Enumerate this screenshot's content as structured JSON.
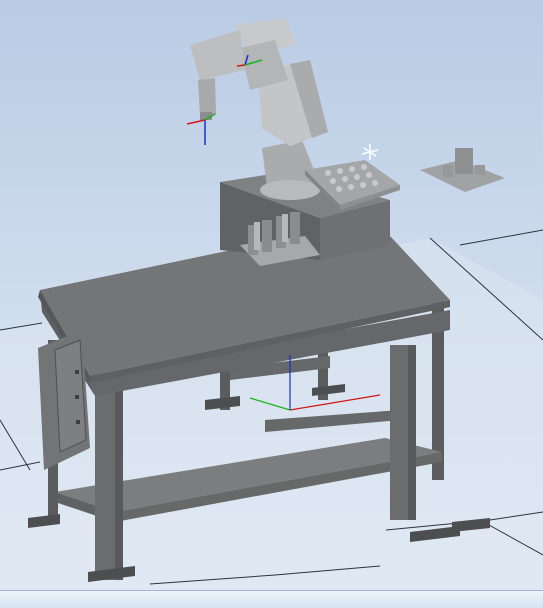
{
  "viewport": {
    "background_top": "#b9cce4",
    "background_bottom": "#e4ecf6",
    "floor_color": "#dde6f0",
    "floor_line_color": "#2c3440"
  },
  "scene": {
    "objects": [
      {
        "name": "workbench-table",
        "color": "#6f7173"
      },
      {
        "name": "robot-pedestal",
        "color": "#7a7c7e"
      },
      {
        "name": "industrial-robot-arm",
        "color": "#c4c6c8"
      },
      {
        "name": "electrical-cabinet",
        "color": "#717375"
      },
      {
        "name": "tool-rack",
        "color": "#9c9ea0"
      },
      {
        "name": "pin-fixture-plate",
        "color": "#a4a6a8"
      },
      {
        "name": "remote-fixture",
        "color": "#999b9d"
      }
    ],
    "axis_colors": {
      "x": "#d01818",
      "y": "#18b018",
      "z": "#1830d0"
    }
  }
}
